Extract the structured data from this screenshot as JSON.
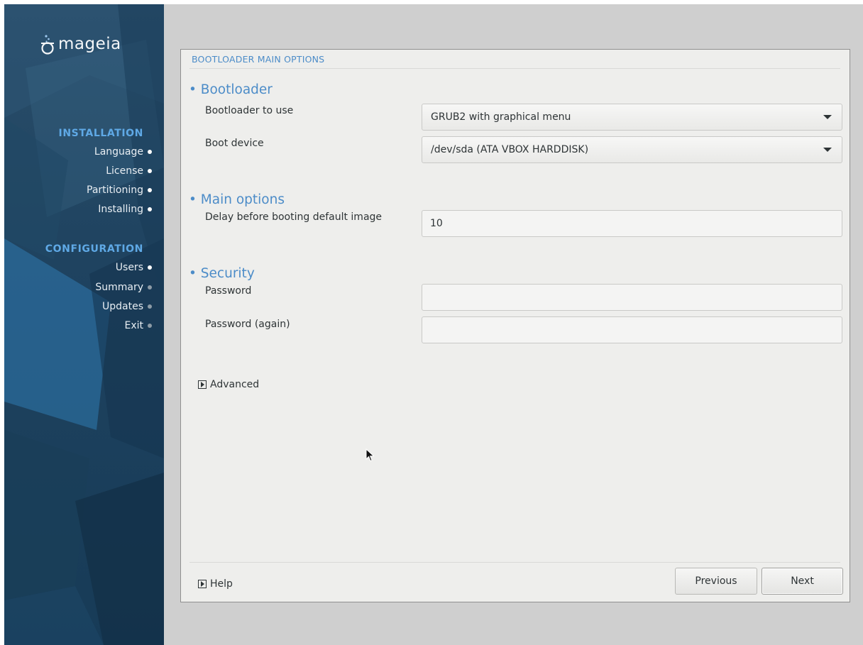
{
  "logo": {
    "text": "mageia",
    "icon": "mageia-cauldron-icon"
  },
  "sidebar": {
    "sections": [
      {
        "title": "INSTALLATION",
        "items": [
          {
            "label": "Language",
            "state": "done"
          },
          {
            "label": "License",
            "state": "done"
          },
          {
            "label": "Partitioning",
            "state": "done"
          },
          {
            "label": "Installing",
            "state": "done"
          }
        ]
      },
      {
        "title": "CONFIGURATION",
        "items": [
          {
            "label": "Users",
            "state": "current"
          },
          {
            "label": "Summary",
            "state": "pending"
          },
          {
            "label": "Updates",
            "state": "pending"
          },
          {
            "label": "Exit",
            "state": "pending"
          }
        ]
      }
    ]
  },
  "panel": {
    "frame_title": "BOOTLOADER MAIN OPTIONS",
    "bootloader": {
      "title": "• Bootloader",
      "bootloader_label": "Bootloader to use",
      "bootloader_value": "GRUB2 with graphical menu",
      "device_label": "Boot device",
      "device_value": "/dev/sda (ATA VBOX HARDDISK)"
    },
    "main_options": {
      "title": "• Main options",
      "delay_label": "Delay before booting default image",
      "delay_value": "10"
    },
    "security": {
      "title": "• Security",
      "password_label": "Password",
      "password_value": "",
      "password_again_label": "Password (again)",
      "password_again_value": ""
    },
    "advanced_label": "Advanced",
    "help_label": "Help",
    "previous_label": "Previous",
    "next_label": "Next"
  },
  "colors": {
    "accent": "#4c8cc8",
    "sidebar_section": "#5fa9e6",
    "sidebar_bg": "#1f4360",
    "panel_bg": "#eeeeec",
    "desktop_bg": "#cfcfcf"
  }
}
